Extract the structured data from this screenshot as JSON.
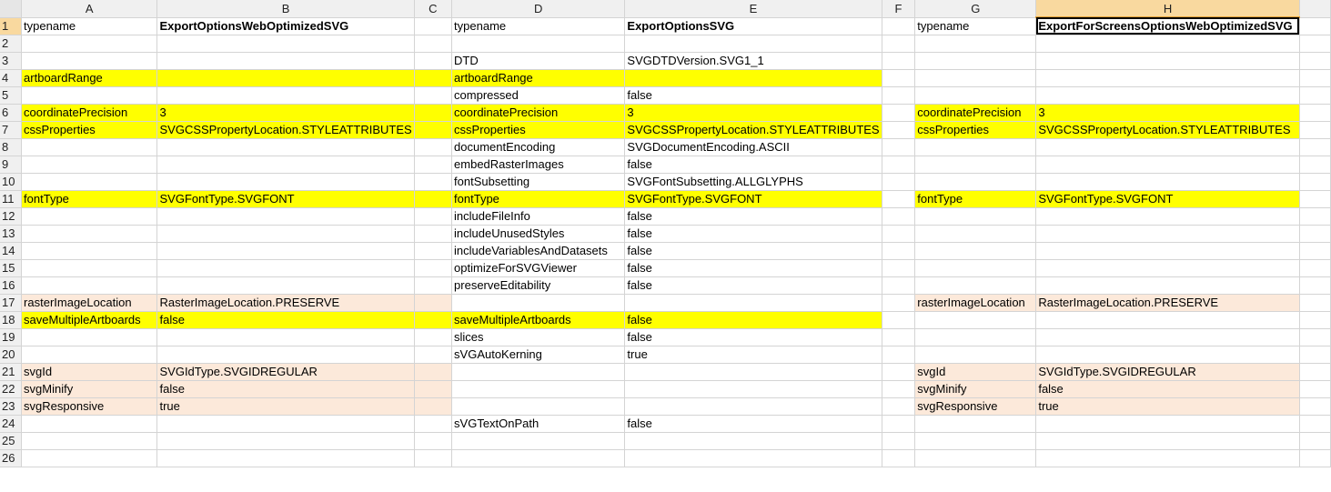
{
  "colors": {
    "yellow": "#ffff00",
    "peach": "#fce9da",
    "header": "#f0f0f0",
    "selected_header": "#f9d99f"
  },
  "columns": [
    "A",
    "B",
    "C",
    "D",
    "E",
    "F",
    "G",
    "H"
  ],
  "selected_column": "H",
  "selected_row": "1",
  "active_cell": "H1",
  "rows": [
    {
      "n": "1",
      "cells": [
        "typename",
        "ExportOptionsWebOptimizedSVG",
        "",
        "typename",
        "ExportOptionsSVG",
        "",
        "typename",
        "ExportForScreensOptionsWebOptimizedSVG"
      ],
      "fill": [
        "",
        "",
        "",
        "",
        "",
        "",
        "",
        ""
      ]
    },
    {
      "n": "2",
      "cells": [
        "",
        "",
        "",
        "",
        "",
        "",
        "",
        ""
      ],
      "fill": [
        "",
        "",
        "",
        "",
        "",
        "",
        "",
        ""
      ]
    },
    {
      "n": "3",
      "cells": [
        "",
        "",
        "",
        "DTD",
        "SVGDTDVersion.SVG1_1",
        "",
        "",
        ""
      ],
      "fill": [
        "",
        "",
        "",
        "",
        "",
        "",
        "",
        ""
      ]
    },
    {
      "n": "4",
      "cells": [
        "artboardRange",
        "",
        "",
        "artboardRange",
        "",
        "",
        "",
        ""
      ],
      "fill": [
        "y",
        "y",
        "y",
        "y",
        "y",
        "",
        "",
        ""
      ]
    },
    {
      "n": "5",
      "cells": [
        "",
        "",
        "",
        "compressed",
        "false",
        "",
        "",
        ""
      ],
      "fill": [
        "",
        "",
        "",
        "",
        "",
        "",
        "",
        ""
      ]
    },
    {
      "n": "6",
      "cells": [
        "coordinatePrecision",
        "3",
        "",
        "coordinatePrecision",
        "3",
        "",
        "coordinatePrecision",
        "3"
      ],
      "fill": [
        "y",
        "y",
        "y",
        "y",
        "y",
        "",
        "y",
        "y"
      ]
    },
    {
      "n": "7",
      "cells": [
        "cssProperties",
        "SVGCSSPropertyLocation.STYLEATTRIBUTES",
        "",
        "cssProperties",
        "SVGCSSPropertyLocation.STYLEATTRIBUTES",
        "",
        "cssProperties",
        "SVGCSSPropertyLocation.STYLEATTRIBUTES"
      ],
      "fill": [
        "y",
        "y",
        "y",
        "y",
        "y",
        "",
        "y",
        "y"
      ]
    },
    {
      "n": "8",
      "cells": [
        "",
        "",
        "",
        "documentEncoding",
        "SVGDocumentEncoding.ASCII",
        "",
        "",
        ""
      ],
      "fill": [
        "",
        "",
        "",
        "",
        "",
        "",
        "",
        ""
      ]
    },
    {
      "n": "9",
      "cells": [
        "",
        "",
        "",
        "embedRasterImages",
        "false",
        "",
        "",
        ""
      ],
      "fill": [
        "",
        "",
        "",
        "",
        "",
        "",
        "",
        ""
      ]
    },
    {
      "n": "10",
      "cells": [
        "",
        "",
        "",
        "fontSubsetting",
        "SVGFontSubsetting.ALLGLYPHS",
        "",
        "",
        ""
      ],
      "fill": [
        "",
        "",
        "",
        "",
        "",
        "",
        "",
        ""
      ]
    },
    {
      "n": "11",
      "cells": [
        "fontType",
        "SVGFontType.SVGFONT",
        "",
        "fontType",
        "SVGFontType.SVGFONT",
        "",
        "fontType",
        "SVGFontType.SVGFONT"
      ],
      "fill": [
        "y",
        "y",
        "y",
        "y",
        "y",
        "",
        "y",
        "y"
      ]
    },
    {
      "n": "12",
      "cells": [
        "",
        "",
        "",
        "includeFileInfo",
        "false",
        "",
        "",
        ""
      ],
      "fill": [
        "",
        "",
        "",
        "",
        "",
        "",
        "",
        ""
      ]
    },
    {
      "n": "13",
      "cells": [
        "",
        "",
        "",
        "includeUnusedStyles",
        "false",
        "",
        "",
        ""
      ],
      "fill": [
        "",
        "",
        "",
        "",
        "",
        "",
        "",
        ""
      ]
    },
    {
      "n": "14",
      "cells": [
        "",
        "",
        "",
        "includeVariablesAndDatasets",
        "false",
        "",
        "",
        ""
      ],
      "fill": [
        "",
        "",
        "",
        "",
        "",
        "",
        "",
        ""
      ]
    },
    {
      "n": "15",
      "cells": [
        "",
        "",
        "",
        "optimizeForSVGViewer",
        "false",
        "",
        "",
        ""
      ],
      "fill": [
        "",
        "",
        "",
        "",
        "",
        "",
        "",
        ""
      ]
    },
    {
      "n": "16",
      "cells": [
        "",
        "",
        "",
        "preserveEditability",
        "false",
        "",
        "",
        ""
      ],
      "fill": [
        "",
        "",
        "",
        "",
        "",
        "",
        "",
        ""
      ]
    },
    {
      "n": "17",
      "cells": [
        "rasterImageLocation",
        "RasterImageLocation.PRESERVE",
        "",
        "",
        "",
        "",
        "rasterImageLocation",
        "RasterImageLocation.PRESERVE"
      ],
      "fill": [
        "p",
        "p",
        "p",
        "",
        "",
        "",
        "p",
        "p"
      ]
    },
    {
      "n": "18",
      "cells": [
        "saveMultipleArtboards",
        "false",
        "",
        "saveMultipleArtboards",
        "false",
        "",
        "",
        ""
      ],
      "fill": [
        "y",
        "y",
        "y",
        "y",
        "y",
        "",
        "",
        ""
      ]
    },
    {
      "n": "19",
      "cells": [
        "",
        "",
        "",
        "slices",
        "false",
        "",
        "",
        ""
      ],
      "fill": [
        "",
        "",
        "",
        "",
        "",
        "",
        "",
        ""
      ]
    },
    {
      "n": "20",
      "cells": [
        "",
        "",
        "",
        "sVGAutoKerning",
        "true",
        "",
        "",
        ""
      ],
      "fill": [
        "",
        "",
        "",
        "",
        "",
        "",
        "",
        ""
      ]
    },
    {
      "n": "21",
      "cells": [
        "svgId",
        "SVGIdType.SVGIDREGULAR",
        "",
        "",
        "",
        "",
        "svgId",
        "SVGIdType.SVGIDREGULAR"
      ],
      "fill": [
        "p",
        "p",
        "p",
        "",
        "",
        "",
        "p",
        "p"
      ]
    },
    {
      "n": "22",
      "cells": [
        "svgMinify",
        "false",
        "",
        "",
        "",
        "",
        "svgMinify",
        "false"
      ],
      "fill": [
        "p",
        "p",
        "p",
        "",
        "",
        "",
        "p",
        "p"
      ]
    },
    {
      "n": "23",
      "cells": [
        "svgResponsive",
        "true",
        "",
        "",
        "",
        "",
        "svgResponsive",
        "true"
      ],
      "fill": [
        "p",
        "p",
        "p",
        "",
        "",
        "",
        "p",
        "p"
      ]
    },
    {
      "n": "24",
      "cells": [
        "",
        "",
        "",
        "sVGTextOnPath",
        "false",
        "",
        "",
        ""
      ],
      "fill": [
        "",
        "",
        "",
        "",
        "",
        "",
        "",
        ""
      ]
    },
    {
      "n": "25",
      "cells": [
        "",
        "",
        "",
        "",
        "",
        "",
        "",
        ""
      ],
      "fill": [
        "",
        "",
        "",
        "",
        "",
        "",
        "",
        ""
      ]
    },
    {
      "n": "26",
      "cells": [
        "",
        "",
        "",
        "",
        "",
        "",
        "",
        ""
      ],
      "fill": [
        "",
        "",
        "",
        "",
        "",
        "",
        "",
        ""
      ]
    }
  ]
}
